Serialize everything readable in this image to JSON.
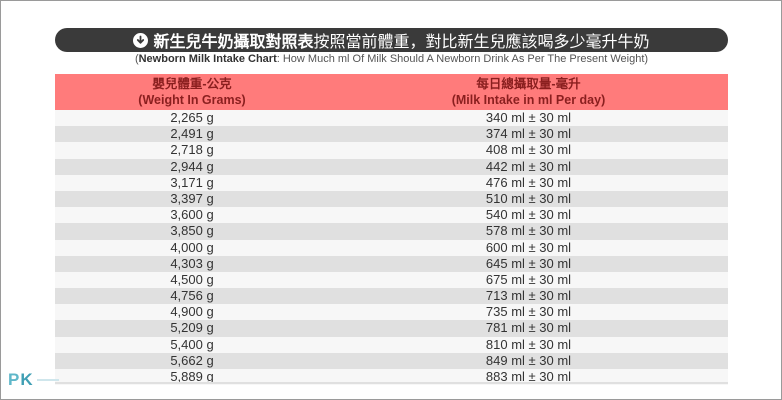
{
  "title": {
    "bold": "新生兒牛奶攝取對照表",
    "rest": " 按照當前體重，對比新生兒應該喝多少毫升牛奶"
  },
  "subtitle": {
    "open": "(",
    "bold": "Newborn Milk Intake Chart",
    "rest": ": How Much ml Of Milk Should A Newborn Drink As Per The Present Weight)"
  },
  "table": {
    "headers": [
      {
        "line1": "嬰兒體重-公克",
        "line2": "(Weight In Grams)"
      },
      {
        "line1": "每日總攝取量-毫升",
        "line2": "(Milk Intake in ml Per day)"
      }
    ],
    "rows": [
      [
        "2,265 g",
        "340 ml ± 30 ml"
      ],
      [
        "2,491 g",
        "374 ml ± 30 ml"
      ],
      [
        "2,718 g",
        "408 ml ± 30 ml"
      ],
      [
        "2,944 g",
        "442 ml ± 30 ml"
      ],
      [
        "3,171 g",
        "476 ml ± 30 ml"
      ],
      [
        "3,397 g",
        "510 ml ± 30 ml"
      ],
      [
        "3,600 g",
        "540 ml ± 30 ml"
      ],
      [
        "3,850 g",
        "578 ml ± 30 ml"
      ],
      [
        "4,000 g",
        "600 ml ± 30 ml"
      ],
      [
        "4,303 g",
        "645 ml ± 30 ml"
      ],
      [
        "4,500 g",
        "675 ml ± 30 ml"
      ],
      [
        "4,756 g",
        "713 ml ± 30 ml"
      ],
      [
        "4,900 g",
        "735 ml ± 30 ml"
      ],
      [
        "5,209 g",
        "781 ml ± 30 ml"
      ],
      [
        "5,400 g",
        "810 ml ± 30 ml"
      ],
      [
        "5,662 g",
        "849 ml ± 30 ml"
      ],
      [
        "5,889 g",
        "883 ml ± 30 ml"
      ]
    ]
  },
  "logo": {
    "p": "P",
    "k": "K"
  },
  "icons": {
    "title": "download-circle-icon"
  },
  "colors": {
    "header_bg": "#ff7b7b",
    "title_bg": "#3a3a3a",
    "logo": "#5fb7c9"
  }
}
